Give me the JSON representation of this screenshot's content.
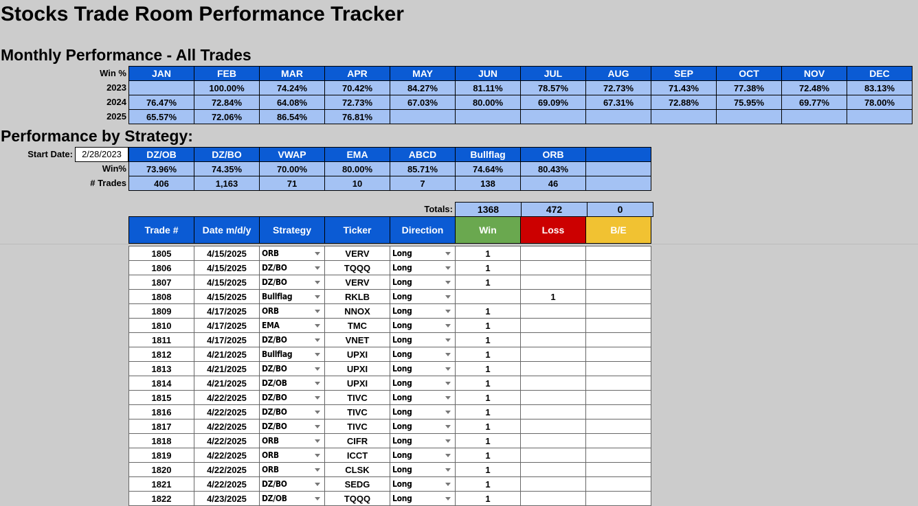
{
  "title": "Stocks Trade Room Performance Tracker",
  "monthly": {
    "heading": "Monthly Performance - All Trades",
    "corner_label": "Win %",
    "months": [
      "JAN",
      "FEB",
      "MAR",
      "APR",
      "MAY",
      "JUN",
      "JUL",
      "AUG",
      "SEP",
      "OCT",
      "NOV",
      "DEC"
    ],
    "rows": [
      {
        "year": "2023",
        "values": [
          "",
          "100.00%",
          "74.24%",
          "70.42%",
          "84.27%",
          "81.11%",
          "78.57%",
          "72.73%",
          "71.43%",
          "77.38%",
          "72.48%",
          "83.13%"
        ]
      },
      {
        "year": "2024",
        "values": [
          "76.47%",
          "72.84%",
          "64.08%",
          "72.73%",
          "67.03%",
          "80.00%",
          "69.09%",
          "67.31%",
          "72.88%",
          "75.95%",
          "69.77%",
          "78.00%"
        ]
      },
      {
        "year": "2025",
        "values": [
          "65.57%",
          "72.06%",
          "86.54%",
          "76.81%",
          "",
          "",
          "",
          "",
          "",
          "",
          "",
          ""
        ]
      }
    ]
  },
  "strategy": {
    "heading": "Performance by Strategy:",
    "start_label": "Start Date:",
    "start_date": "2/28/2023",
    "win_label": "Win%",
    "trades_label": "# Trades",
    "names": [
      "DZ/OB",
      "DZ/BO",
      "VWAP",
      "EMA",
      "ABCD",
      "Bullflag",
      "ORB",
      ""
    ],
    "win": [
      "73.96%",
      "74.35%",
      "70.00%",
      "80.00%",
      "85.71%",
      "74.64%",
      "80.43%",
      ""
    ],
    "trades": [
      "406",
      "1,163",
      "71",
      "10",
      "7",
      "138",
      "46",
      ""
    ]
  },
  "totals": {
    "label": "Totals:",
    "win": "1368",
    "loss": "472",
    "be": "0"
  },
  "trade_table": {
    "headers": [
      "Trade #",
      "Date m/d/y",
      "Strategy",
      "Ticker",
      "Direction",
      "Win",
      "Loss",
      "B/E"
    ],
    "rows": [
      {
        "num": "1805",
        "date": "4/15/2025",
        "strategy": "ORB",
        "ticker": "VERV",
        "direction": "Long",
        "win": "1",
        "loss": "",
        "be": ""
      },
      {
        "num": "1806",
        "date": "4/15/2025",
        "strategy": "DZ/BO",
        "ticker": "TQQQ",
        "direction": "Long",
        "win": "1",
        "loss": "",
        "be": ""
      },
      {
        "num": "1807",
        "date": "4/15/2025",
        "strategy": "DZ/BO",
        "ticker": "VERV",
        "direction": "Long",
        "win": "1",
        "loss": "",
        "be": ""
      },
      {
        "num": "1808",
        "date": "4/15/2025",
        "strategy": "Bullflag",
        "ticker": "RKLB",
        "direction": "Long",
        "win": "",
        "loss": "1",
        "be": ""
      },
      {
        "num": "1809",
        "date": "4/17/2025",
        "strategy": "ORB",
        "ticker": "NNOX",
        "direction": "Long",
        "win": "1",
        "loss": "",
        "be": ""
      },
      {
        "num": "1810",
        "date": "4/17/2025",
        "strategy": "EMA",
        "ticker": "TMC",
        "direction": "Long",
        "win": "1",
        "loss": "",
        "be": ""
      },
      {
        "num": "1811",
        "date": "4/17/2025",
        "strategy": "DZ/BO",
        "ticker": "VNET",
        "direction": "Long",
        "win": "1",
        "loss": "",
        "be": ""
      },
      {
        "num": "1812",
        "date": "4/21/2025",
        "strategy": "Bullflag",
        "ticker": "UPXI",
        "direction": "Long",
        "win": "1",
        "loss": "",
        "be": ""
      },
      {
        "num": "1813",
        "date": "4/21/2025",
        "strategy": "DZ/BO",
        "ticker": "UPXI",
        "direction": "Long",
        "win": "1",
        "loss": "",
        "be": ""
      },
      {
        "num": "1814",
        "date": "4/21/2025",
        "strategy": "DZ/OB",
        "ticker": "UPXI",
        "direction": "Long",
        "win": "1",
        "loss": "",
        "be": ""
      },
      {
        "num": "1815",
        "date": "4/22/2025",
        "strategy": "DZ/BO",
        "ticker": "TIVC",
        "direction": "Long",
        "win": "1",
        "loss": "",
        "be": ""
      },
      {
        "num": "1816",
        "date": "4/22/2025",
        "strategy": "DZ/BO",
        "ticker": "TIVC",
        "direction": "Long",
        "win": "1",
        "loss": "",
        "be": ""
      },
      {
        "num": "1817",
        "date": "4/22/2025",
        "strategy": "DZ/BO",
        "ticker": "TIVC",
        "direction": "Long",
        "win": "1",
        "loss": "",
        "be": ""
      },
      {
        "num": "1818",
        "date": "4/22/2025",
        "strategy": "ORB",
        "ticker": "CIFR",
        "direction": "Long",
        "win": "1",
        "loss": "",
        "be": ""
      },
      {
        "num": "1819",
        "date": "4/22/2025",
        "strategy": "ORB",
        "ticker": "ICCT",
        "direction": "Long",
        "win": "1",
        "loss": "",
        "be": ""
      },
      {
        "num": "1820",
        "date": "4/22/2025",
        "strategy": "ORB",
        "ticker": "CLSK",
        "direction": "Long",
        "win": "1",
        "loss": "",
        "be": ""
      },
      {
        "num": "1821",
        "date": "4/22/2025",
        "strategy": "DZ/BO",
        "ticker": "SEDG",
        "direction": "Long",
        "win": "1",
        "loss": "",
        "be": ""
      },
      {
        "num": "1822",
        "date": "4/23/2025",
        "strategy": "DZ/OB",
        "ticker": "TQQQ",
        "direction": "Long",
        "win": "1",
        "loss": "",
        "be": ""
      }
    ]
  }
}
